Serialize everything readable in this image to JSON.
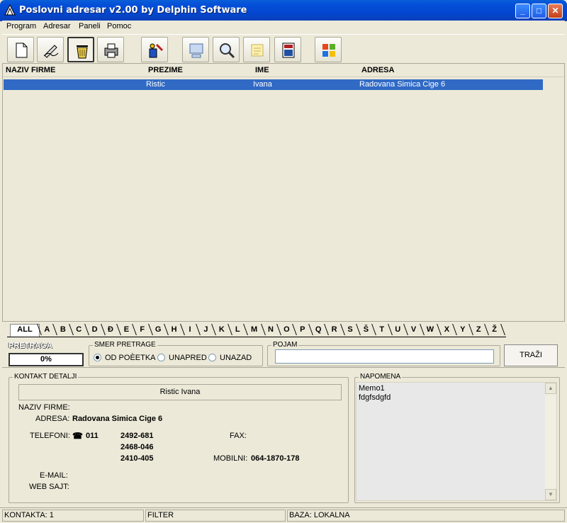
{
  "window": {
    "title": "Poslovni adresar v2.00 by Delphin Software"
  },
  "titlebar": {
    "minimize": "_",
    "maximize": "□",
    "close": "✕"
  },
  "menu": [
    "Program",
    "Adresar",
    "Paneli",
    "Pomoc"
  ],
  "toolbar": {
    "icons": [
      "new-document-icon",
      "edit-icon",
      "delete-trash-icon",
      "print-icon",
      "tools-icon",
      "computer-icon",
      "search-magnifier-icon",
      "notes-icon",
      "calculator-icon",
      "windows-logo-icon"
    ]
  },
  "list": {
    "columns": [
      "NAZIV FIRME",
      "PREZIME",
      "IME",
      "ADRESA"
    ],
    "rows": [
      {
        "naziv_firme": "",
        "prezime": "Ristic",
        "ime": "Ivana",
        "adresa": "Radovana Simica Cige 6"
      }
    ],
    "selected_color": "#316ac5"
  },
  "tabs": [
    "ALL",
    "A",
    "B",
    "C",
    "D",
    "Đ",
    "E",
    "F",
    "G",
    "H",
    "I",
    "J",
    "K",
    "L",
    "M",
    "N",
    "O",
    "P",
    "Q",
    "R",
    "S",
    "Š",
    "T",
    "U",
    "V",
    "W",
    "X",
    "Y",
    "Z",
    "Ž"
  ],
  "search": {
    "pretraga_label": "PRETRAGA",
    "progress": "0%",
    "direction_title": "SMER PRETRAGE",
    "options": [
      "OD POÈETKA",
      "UNAPRED",
      "UNAZAD"
    ],
    "selected_option": "OD POÈETKA",
    "pojam_title": "POJAM",
    "pojam_value": "",
    "button": "TRAŽI"
  },
  "contact": {
    "section_title": "KONTAKT DETALJI",
    "full_name": "Ristic Ivana",
    "labels": {
      "naziv_firme": "NAZIV FIRME:",
      "adresa": "ADRESA:",
      "telefoni": "TELEFONI:",
      "fax": "FAX:",
      "mobilni": "MOBILNI:",
      "email": "E-MAIL:",
      "web": "WEB SAJT:"
    },
    "naziv_firme": "",
    "adresa": "Radovana Simica Cige 6",
    "phone_prefix": "011",
    "phones": [
      "2492-681",
      "2468-046",
      "2410-405"
    ],
    "fax": "",
    "mobilni": "064-1870-178",
    "email": "",
    "web": ""
  },
  "notes": {
    "title": "NAPOMENA",
    "lines": [
      "Memo1",
      "fdgfsdgfd"
    ]
  },
  "status": {
    "kontakta": "KONTAKTA: 1",
    "filter": "FILTER",
    "baza": "BAZA: LOKALNA"
  }
}
